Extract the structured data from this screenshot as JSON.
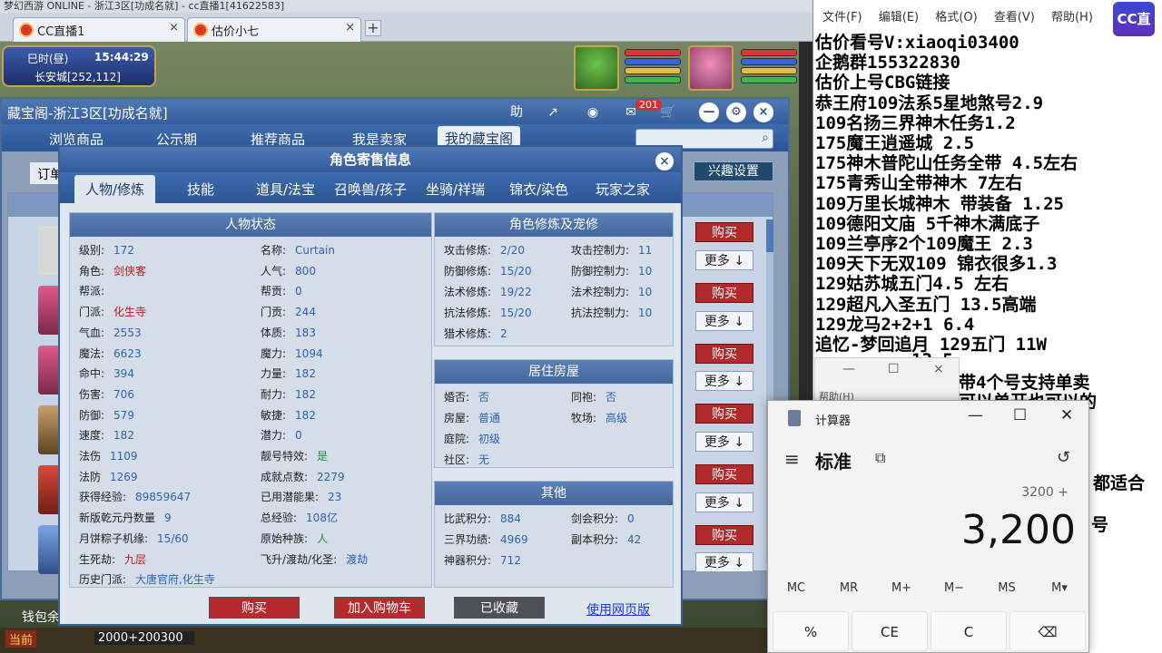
{
  "browser": {
    "title": "梦幻西游 ONLINE - 浙江3区[功成名就] - cc直播1[41622583]",
    "tabs": [
      {
        "label": "CC直播1",
        "close": "×"
      },
      {
        "label": "估价小七",
        "close": "×"
      }
    ],
    "new_tab": "+"
  },
  "game_hud": {
    "time_label": "巳时(昼)",
    "clock": "15:44:29",
    "location": "长安城[252,112]"
  },
  "shop": {
    "title": "藏宝阁-浙江3区[功成名就]",
    "help": "助",
    "badge": "201",
    "nav": [
      "浏览商品",
      "公示期",
      "推荐商品",
      "我是卖家",
      "我的藏宝阁"
    ],
    "order_label": "订单",
    "interest_label": "兴趣设置",
    "buy_label": "购买",
    "more_label": "更多",
    "wallet_label": "钱包余额",
    "bottom_text": "2000+200300",
    "bottom_left": "当前"
  },
  "dialog": {
    "title": "角色寄售信息",
    "close": "×",
    "tabs": [
      "人物/修炼",
      "技能",
      "道具/法宝",
      "召唤兽/孩子",
      "坐骑/祥瑞",
      "锦衣/染色",
      "玩家之家"
    ],
    "panels": {
      "status_title": "人物状态",
      "cultivation_title": "角色修炼及宠修",
      "house_title": "居住房屋",
      "other_title": "其他"
    },
    "status_left": [
      {
        "k": "级别:",
        "v": "172"
      },
      {
        "k": "角色:",
        "v": "剑侠客"
      },
      {
        "k": "帮派:",
        "v": ""
      },
      {
        "k": "门派:",
        "v": "化生寺"
      },
      {
        "k": "气血:",
        "v": "2553"
      },
      {
        "k": "魔法:",
        "v": "6623"
      },
      {
        "k": "命中:",
        "v": "394"
      },
      {
        "k": "伤害:",
        "v": "706"
      },
      {
        "k": "防御:",
        "v": "579"
      },
      {
        "k": "速度:",
        "v": "182"
      },
      {
        "k": "法伤",
        "v": "1109"
      },
      {
        "k": "法防",
        "v": "1269"
      },
      {
        "k": "获得经验:",
        "v": "89859647"
      },
      {
        "k": "新版乾元丹数量",
        "v": "9"
      },
      {
        "k": "月饼粽子机缘:",
        "v": "15/60"
      },
      {
        "k": "生死劫:",
        "v": "九层"
      },
      {
        "k": "历史门派:",
        "v": "大唐官府,化生寺"
      }
    ],
    "status_right": [
      {
        "k": "名称:",
        "v": "Curtain"
      },
      {
        "k": "人气:",
        "v": "800"
      },
      {
        "k": "帮贡:",
        "v": "0"
      },
      {
        "k": "门贡:",
        "v": "244"
      },
      {
        "k": "体质:",
        "v": "183"
      },
      {
        "k": "魔力:",
        "v": "1094"
      },
      {
        "k": "力量:",
        "v": "182"
      },
      {
        "k": "耐力:",
        "v": "182"
      },
      {
        "k": "敏捷:",
        "v": "182"
      },
      {
        "k": "潜力:",
        "v": "0"
      },
      {
        "k": "靓号特效:",
        "v": "是"
      },
      {
        "k": "成就点数:",
        "v": "2279"
      },
      {
        "k": "已用潜能果:",
        "v": "23"
      },
      {
        "k": "总经验:",
        "v": "108亿"
      },
      {
        "k": "原始种族:",
        "v": "人"
      },
      {
        "k": "飞升/渡劫/化圣:",
        "v": "渡劫"
      }
    ],
    "cultivation": [
      {
        "k": "攻击修炼:",
        "v": "2/20",
        "k2": "攻击控制力:",
        "v2": "11"
      },
      {
        "k": "防御修炼:",
        "v": "15/20",
        "k2": "防御控制力:",
        "v2": "10"
      },
      {
        "k": "法术修炼:",
        "v": "19/22",
        "k2": "法术控制力:",
        "v2": "10"
      },
      {
        "k": "抗法修炼:",
        "v": "15/20",
        "k2": "抗法控制力:",
        "v2": "10"
      },
      {
        "k": "猎术修炼:",
        "v": "2",
        "k2": "",
        "v2": ""
      }
    ],
    "house": [
      {
        "k": "婚否:",
        "v": "否",
        "k2": "同袍:",
        "v2": "否"
      },
      {
        "k": "房屋:",
        "v": "普通",
        "k2": "牧场:",
        "v2": "高级"
      },
      {
        "k": "庭院:",
        "v": "初级",
        "k2": "",
        "v2": ""
      },
      {
        "k": "社区:",
        "v": "无",
        "k2": "",
        "v2": ""
      }
    ],
    "other": [
      {
        "k": "比武积分:",
        "v": "884",
        "k2": "剑会积分:",
        "v2": "0"
      },
      {
        "k": "三界功绩:",
        "v": "4969",
        "k2": "副本积分:",
        "v2": "42"
      },
      {
        "k": "神器积分:",
        "v": "712",
        "k2": "",
        "v2": ""
      }
    ],
    "buttons": {
      "buy": "购买",
      "add_cart": "加入购物车",
      "collected": "已收藏",
      "web": "使用网页版"
    }
  },
  "notepad": {
    "menu": [
      "文件(F)",
      "编辑(E)",
      "格式(O)",
      "查看(V)",
      "帮助(H)"
    ],
    "lines": [
      "估价看号V:xiaoqi03400",
      "企鹅群155322830",
      "估价上号CBG链接",
      "恭王府109法系5星地煞号2.9",
      "109名扬三界神木任务1.2",
      "175魔王逍遥城 2.5",
      "175神木普陀山任务全带 4.5左右",
      "175青秀山全带神木  7左右",
      "109万里长城神木 带装备  1.25",
      "109德阳文庙 5千神木满底子",
      "109兰亭序2个109魔王 2.3",
      "109天下无双109  锦衣很多1.3",
      "129姑苏城五门4.5 左右",
      "129超凡入圣五门  13.5高端",
      "129龙马2+2+1  6.4",
      "追忆-梦回追月 129五门 11W",
      "13.5",
      "带4个号支持单卖",
      "可以单开也可以的",
      "都适合",
      "号"
    ],
    "help_menu": "帮助(H)",
    "logo": "CC直播"
  },
  "calculator": {
    "title": "计算器",
    "mode": "标准",
    "expression": "3200 +",
    "display": "3,200",
    "memory": [
      "MC",
      "MR",
      "M+",
      "M−",
      "MS",
      "M▾"
    ],
    "keys": [
      "%",
      "CE",
      "C",
      "⌫"
    ]
  }
}
